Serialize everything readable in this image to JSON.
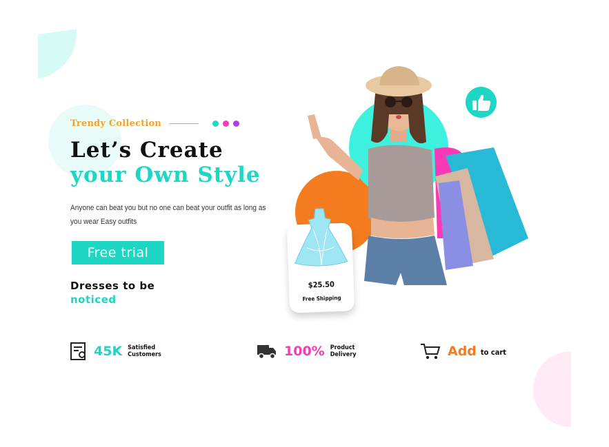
{
  "colors": {
    "teal": "#1dd6c4",
    "orange": "#f5a327",
    "magenta": "#f93ab7",
    "purple": "#b23bf0",
    "cart_orange": "#f57c1e"
  },
  "hero": {
    "eyebrow": "Trendy Collection",
    "headline_line1": "Let’s Create",
    "headline_line2": "your Own Style",
    "description": "Anyone can beat you but no one can beat your outfit as long as you wear Easy outfits",
    "cta_label": "Free trial",
    "sub_line1": "Dresses to be",
    "sub_line2": "noticed"
  },
  "product_card": {
    "price": "$25.50",
    "shipping": "Free Shipping"
  },
  "features": [
    {
      "icon": "certificate-icon",
      "value": "45K",
      "label_line1": "Satisfied",
      "label_line2": "Customers"
    },
    {
      "icon": "truck-icon",
      "value": "100%",
      "label_line1": "Product",
      "label_line2": "Delivery"
    },
    {
      "icon": "cart-icon",
      "value": "Add",
      "label": "to cart"
    }
  ]
}
